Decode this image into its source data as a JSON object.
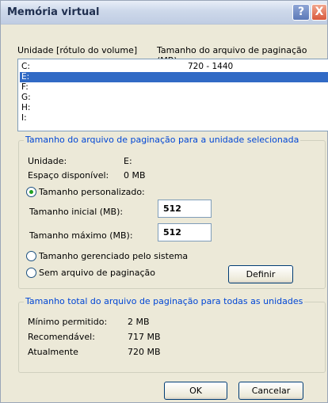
{
  "window": {
    "title": "Memória virtual",
    "help_glyph": "?",
    "close_glyph": "X"
  },
  "drives": {
    "header_drive": "Unidade [rótulo do volume]",
    "header_size": "Tamanho do arquivo de paginação (MB)",
    "rows": [
      {
        "letter": "C:",
        "size": "720 - 1440"
      },
      {
        "letter": "E:",
        "size": ""
      },
      {
        "letter": "F:",
        "size": ""
      },
      {
        "letter": "G:",
        "size": ""
      },
      {
        "letter": "H:",
        "size": ""
      },
      {
        "letter": "I:",
        "size": ""
      }
    ],
    "selected": "E:"
  },
  "selected_group": {
    "title": "Tamanho do arquivo de paginação para a unidade selecionada",
    "drive_label": "Unidade:",
    "drive_value": "E:",
    "space_label": "Espaço disponível:",
    "space_value": "0 MB",
    "custom_size_label": "Tamanho personalizado:",
    "initial_size_label": "Tamanho inicial (MB):",
    "initial_size_value": "512",
    "max_size_label": "Tamanho máximo (MB):",
    "max_size_value": "512",
    "system_managed_label": "Tamanho gerenciado pelo sistema",
    "no_paging_label": "Sem arquivo de paginação",
    "set_button": "Definir",
    "selected_option": "custom"
  },
  "total_group": {
    "title": "Tamanho total do arquivo de paginação para todas as unidades",
    "min_label": "Mínimo permitido:",
    "min_value": "2 MB",
    "recommended_label": "Recomendável:",
    "recommended_value": "717 MB",
    "current_label": "Atualmente",
    "current_value": "720 MB"
  },
  "buttons": {
    "ok": "OK",
    "cancel": "Cancelar"
  }
}
